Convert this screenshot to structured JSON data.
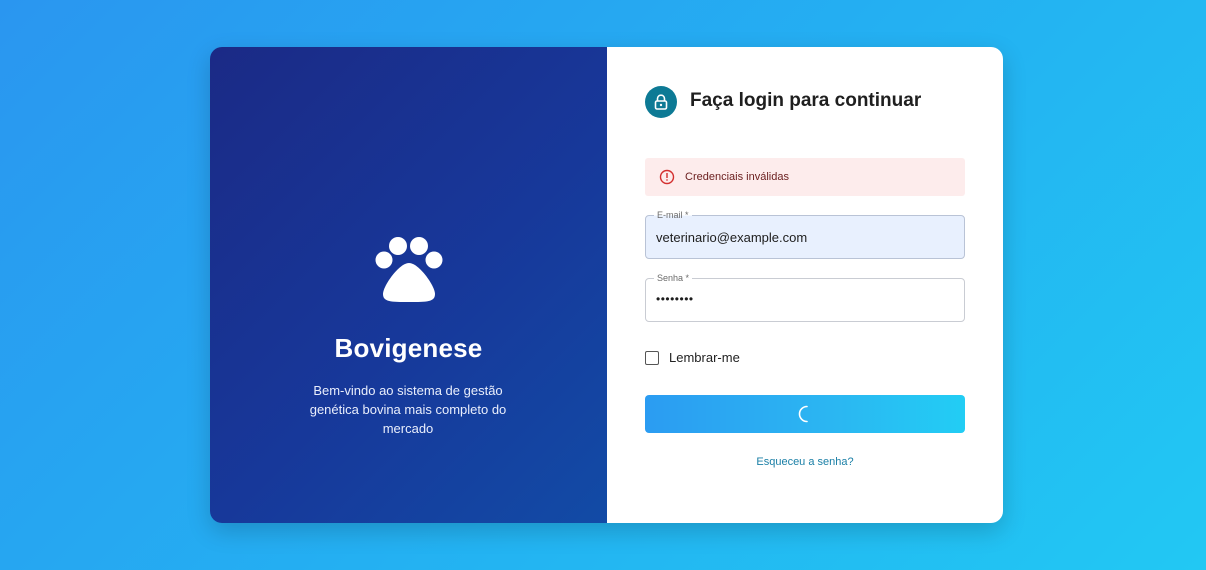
{
  "brand": {
    "name": "Bovigenese",
    "tagline": "Bem-vindo ao sistema de gestão genética bovina mais completo do mercado",
    "logo_icon": "paw-icon"
  },
  "login": {
    "heading": "Faça login para continuar",
    "heading_icon": "lock-icon",
    "alert": {
      "icon": "error-circle-icon",
      "message": "Credenciais inválidas"
    },
    "email": {
      "label": "E-mail *",
      "value": "veterinario@example.com"
    },
    "password": {
      "label": "Senha *",
      "masked_value": "••••••••"
    },
    "remember_label": "Lembrar-me",
    "remember_checked": false,
    "submit_state": "loading",
    "forgot_link": "Esqueceu a senha?"
  },
  "colors": {
    "left_panel": "#17389a",
    "accent": "#0d7a95",
    "alert_bg": "#fdecec",
    "alert_icon": "#d32f2f",
    "link": "#1a7fa6"
  }
}
